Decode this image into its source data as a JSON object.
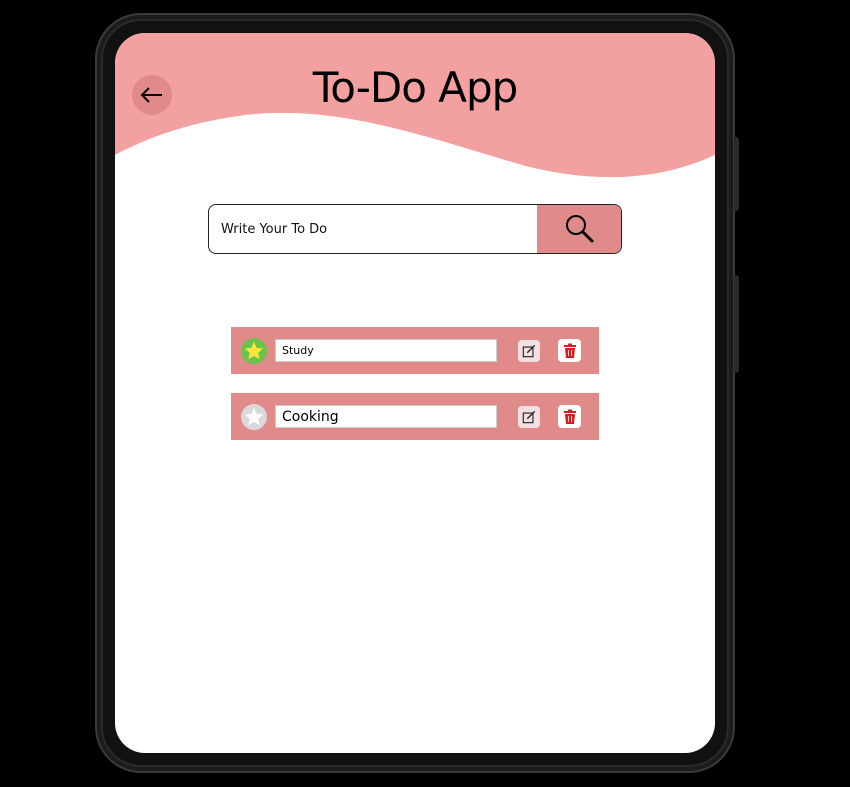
{
  "app": {
    "title": "To-Do App"
  },
  "header": {
    "back_icon": "arrow-left-icon",
    "color": "#f2a0a0",
    "accent": "#e08a8a"
  },
  "search": {
    "placeholder": "Write Your To Do",
    "value": "",
    "button_icon": "magnifier-icon"
  },
  "todos": [
    {
      "text": "Study",
      "starred": true,
      "edit_icon": "edit-icon",
      "delete_icon": "trash-icon"
    },
    {
      "text": "Cooking",
      "starred": false,
      "edit_icon": "edit-icon",
      "delete_icon": "trash-icon"
    }
  ],
  "colors": {
    "item_bg": "#e08a8a",
    "star_active": "#6cc24a",
    "star_inactive": "#d9d9d9",
    "delete_icon": "#d91c1c"
  }
}
